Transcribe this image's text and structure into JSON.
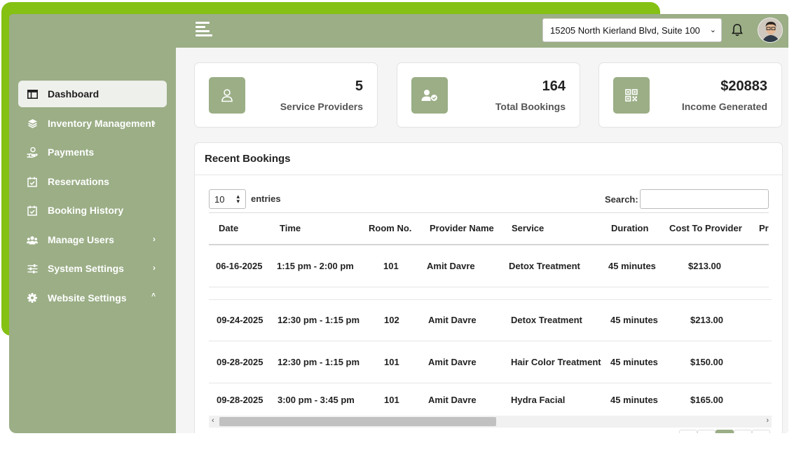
{
  "header": {
    "location": "15205 North Kierland Blvd, Suite 100",
    "location_caret": "⌄"
  },
  "sidebar": {
    "items": [
      {
        "label": "Dashboard",
        "icon": "table-icon",
        "active": true
      },
      {
        "label": "Inventory Management",
        "icon": "layers-icon",
        "chevron": "›"
      },
      {
        "label": "Payments",
        "icon": "hand-dollar-icon"
      },
      {
        "label": "Reservations",
        "icon": "calendar-check-icon"
      },
      {
        "label": "Booking History",
        "icon": "calendar-check-icon"
      },
      {
        "label": "Manage Users",
        "icon": "users-icon",
        "chevron": "›"
      },
      {
        "label": "System Settings",
        "icon": "sliders-icon",
        "chevron": "›"
      },
      {
        "label": "Website Settings",
        "icon": "gear-icon",
        "chevron": "˄"
      }
    ]
  },
  "stats": [
    {
      "value": "5",
      "label": "Service Providers",
      "icon": "user-icon"
    },
    {
      "value": "164",
      "label": "Total Bookings",
      "icon": "user-check-icon"
    },
    {
      "value": "$20883",
      "label": "Income Generated",
      "icon": "qrcode-icon"
    }
  ],
  "bookings": {
    "title": "Recent Bookings",
    "entries_value": "10",
    "entries_label": "entries",
    "search_label": "Search:",
    "columns": [
      "Date",
      "Time",
      "Room No.",
      "Provider Name",
      "Service",
      "Duration",
      "Cost To Provider",
      "Pr"
    ],
    "rows": [
      [
        "06-16-2025",
        "1:15 pm - 2:00 pm",
        "101",
        "Amit Davre",
        "Detox Treatment",
        "45 minutes",
        "$213.00"
      ],
      [
        "09-24-2025",
        "12:30 pm - 1:15 pm",
        "102",
        "Amit Davre",
        "Detox Treatment",
        "45 minutes",
        "$213.00"
      ],
      [
        "09-28-2025",
        "12:30 pm - 1:15 pm",
        "101",
        "Amit Davre",
        "Hair Color Treatment",
        "45 minutes",
        "$150.00"
      ],
      [
        "09-28-2025",
        "3:00 pm - 3:45 pm",
        "101",
        "Amit Davre",
        "Hydra Facial",
        "45 minutes",
        "$165.00"
      ]
    ],
    "scroll_left": "‹",
    "scroll_right": "›"
  },
  "colors": {
    "accent": "#84c113",
    "sage": "#9bae86"
  }
}
